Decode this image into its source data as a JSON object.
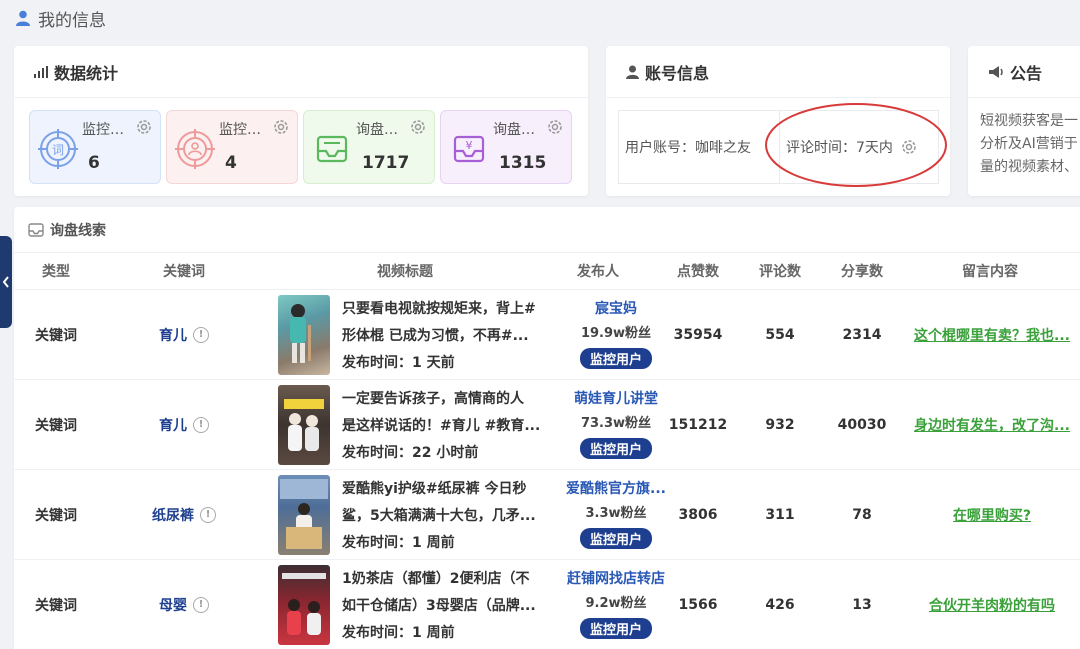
{
  "page_title": "我的信息",
  "stats": {
    "title": "数据统计",
    "items": [
      {
        "label": "监控关键词",
        "value": "6"
      },
      {
        "label": "监控用户",
        "value": "4"
      },
      {
        "label": "询盘总数",
        "value": "1717"
      },
      {
        "label": "询盘评论",
        "value": "1315"
      }
    ]
  },
  "account": {
    "title": "账号信息",
    "user_label": "用户账号：",
    "user_value": "咖啡之友",
    "comment_time_label": "评论时间：",
    "comment_time_value": "7天内"
  },
  "notice": {
    "title": "公告",
    "lines": [
      "短视频获客是一",
      "分析及AI营销于",
      "量的视频素材、"
    ]
  },
  "leads": {
    "title": "询盘线索",
    "columns": [
      "类型",
      "关键词",
      "视频标题",
      "发布人",
      "点赞数",
      "评论数",
      "分享数",
      "留言内容"
    ],
    "rows": [
      {
        "type": "关键词",
        "keyword": "育儿",
        "title_l1": "只要看电视就按规矩来，背上#",
        "title_l2": "形体棍 已成为习惯，不再#...",
        "time": "发布时间：1 天前",
        "author": "宸宝妈",
        "fans": "19.9w粉丝",
        "action": "监控用户",
        "likes": "35954",
        "comments": "554",
        "shares": "2314",
        "message": "这个棍哪里有卖？我也..."
      },
      {
        "type": "关键词",
        "keyword": "育儿",
        "title_l1": "一定要告诉孩子，高情商的人",
        "title_l2": "是这样说话的！#育儿 #教育...",
        "time": "发布时间：22 小时前",
        "author": "萌娃育儿讲堂",
        "fans": "73.3w粉丝",
        "action": "监控用户",
        "likes": "151212",
        "comments": "932",
        "shares": "40030",
        "message": "身边时有发生，改了沟..."
      },
      {
        "type": "关键词",
        "keyword": "纸尿裤",
        "title_l1": "爱酷熊yi护级#纸尿裤 今日秒",
        "title_l2": "鲨，5大箱满满十大包，几矛...",
        "time": "发布时间：1 周前",
        "author": "爱酷熊官方旗...",
        "fans": "3.3w粉丝",
        "action": "监控用户",
        "likes": "3806",
        "comments": "311",
        "shares": "78",
        "message": "在哪里购买?"
      },
      {
        "type": "关键词",
        "keyword": "母婴",
        "title_l1": "1奶茶店（都懂）2便利店（不",
        "title_l2": "如干仓储店）3母婴店（品牌...",
        "time": "发布时间：1 周前",
        "author": "赶铺网找店转店",
        "fans": "9.2w粉丝",
        "action": "监控用户",
        "likes": "1566",
        "comments": "426",
        "shares": "13",
        "message": "合伙开羊肉粉的有吗"
      }
    ]
  },
  "colors": {
    "accent_blue": "#1e3f8f",
    "link_blue": "#2a58b5",
    "comment_green": "#3aa13a",
    "circle_red": "#d93a3a"
  }
}
